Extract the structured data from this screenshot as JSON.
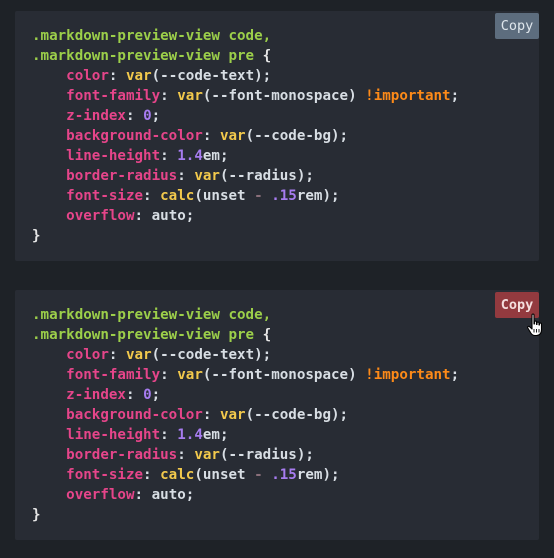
{
  "blocks": [
    {
      "copy_label": "Copy",
      "copy_state": "normal",
      "selector_1": ".markdown-preview-view code,",
      "selector_2": ".markdown-preview-view pre",
      "open_brace": "{",
      "close_brace": "}",
      "lines": [
        {
          "prop": "color",
          "fn": "var",
          "arg": "--code-text"
        },
        {
          "prop": "font-family",
          "fn": "var",
          "arg": "--font-monospace",
          "important": "!important"
        },
        {
          "prop": "z-index",
          "num": "0"
        },
        {
          "prop": "background-color",
          "fn": "var",
          "arg": "--code-bg"
        },
        {
          "prop": "line-height",
          "num": "1.4",
          "unit": "em"
        },
        {
          "prop": "border-radius",
          "fn": "var",
          "arg": "--radius"
        },
        {
          "prop": "font-size",
          "fn": "calc",
          "arg": "unset",
          "op": "-",
          "num": ".15",
          "unit": "rem"
        },
        {
          "prop": "overflow",
          "value": "auto"
        }
      ]
    },
    {
      "copy_label": "Copy",
      "copy_state": "hover",
      "selector_1": ".markdown-preview-view code,",
      "selector_2": ".markdown-preview-view pre",
      "open_brace": "{",
      "close_brace": "}",
      "lines": [
        {
          "prop": "color",
          "fn": "var",
          "arg": "--code-text"
        },
        {
          "prop": "font-family",
          "fn": "var",
          "arg": "--font-monospace",
          "important": "!important"
        },
        {
          "prop": "z-index",
          "num": "0"
        },
        {
          "prop": "background-color",
          "fn": "var",
          "arg": "--code-bg"
        },
        {
          "prop": "line-height",
          "num": "1.4",
          "unit": "em"
        },
        {
          "prop": "border-radius",
          "fn": "var",
          "arg": "--radius"
        },
        {
          "prop": "font-size",
          "fn": "calc",
          "arg": "unset",
          "op": "-",
          "num": ".15",
          "unit": "rem"
        },
        {
          "prop": "overflow",
          "value": "auto"
        }
      ]
    }
  ],
  "cursor_icon": "hand-pointer-icon",
  "colors": {
    "page_bg": "#1e2227",
    "block_bg": "#282c34",
    "copy_normal_bg": "#5d6d7e",
    "copy_hover_bg": "#933a3f",
    "selector": "#9ccf4a",
    "property": "#e6458a",
    "function": "#f2c94c",
    "number": "#a77cf0",
    "important": "#fd8a18"
  }
}
